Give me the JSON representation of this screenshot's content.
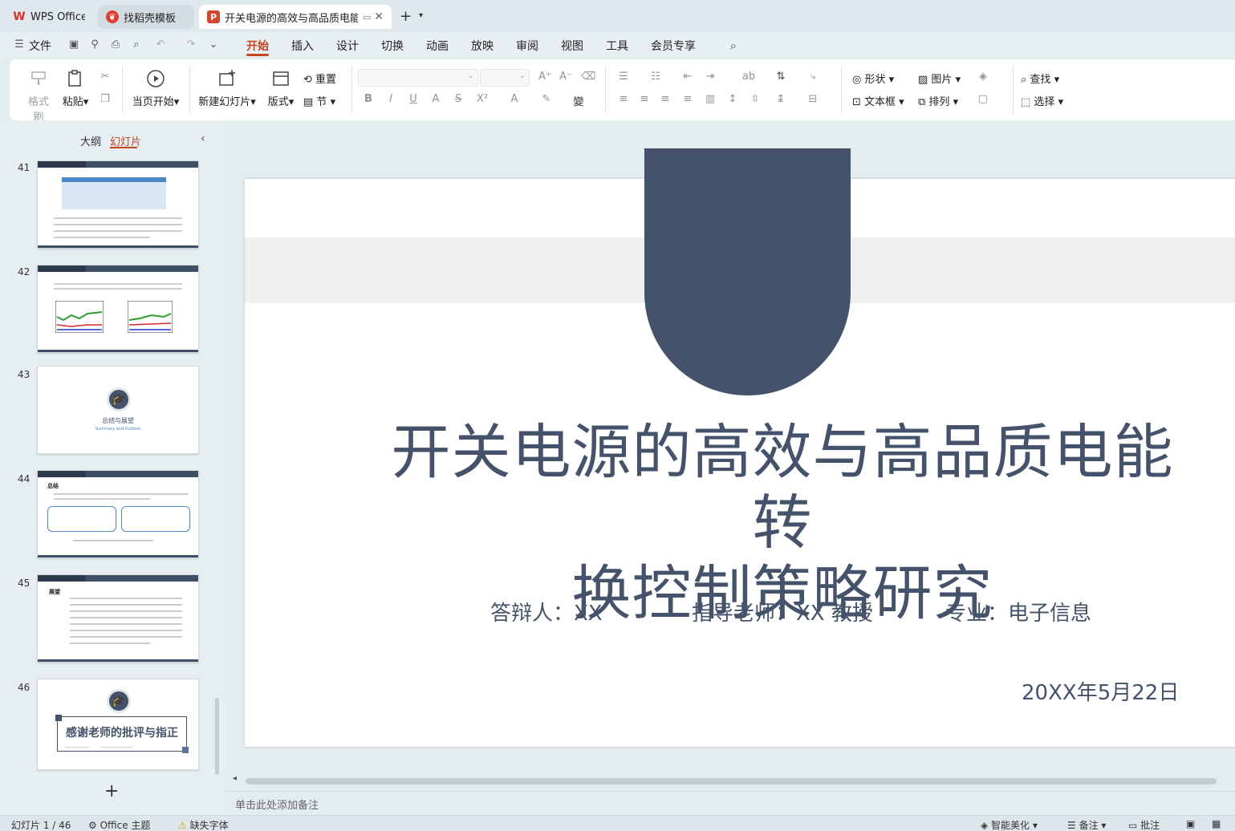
{
  "tabs": [
    {
      "label": "WPS Office",
      "icon": "wps-logo-icon"
    },
    {
      "label": "找稻壳模板",
      "icon": "docer-icon"
    },
    {
      "label": "开关电源的高效与高品质电能转",
      "icon": "presentation-icon"
    }
  ],
  "menu": {
    "file": "文件",
    "items": [
      "开始",
      "插入",
      "设计",
      "切换",
      "动画",
      "放映",
      "审阅",
      "视图",
      "工具",
      "会员专享"
    ],
    "active": "开始"
  },
  "ribbon": {
    "format_painter": "格式刷",
    "paste": "粘贴",
    "start_from_current": "当页开始",
    "new_slide": "新建幻灯片",
    "layout": "版式",
    "reset": "重置",
    "section": "节",
    "shape": "形状",
    "picture": "图片",
    "find": "查找",
    "textbox": "文本框",
    "arrange": "排列",
    "select": "选择"
  },
  "panel": {
    "outline_tab": "大纲",
    "slides_tab": "幻灯片",
    "slides": [
      {
        "num": "41",
        "kind": "table"
      },
      {
        "num": "42",
        "kind": "chart"
      },
      {
        "num": "43",
        "kind": "section",
        "title": "总结与展望",
        "subtitle": "Summary and Outlook"
      },
      {
        "num": "44",
        "kind": "summary",
        "heading": "总结"
      },
      {
        "num": "45",
        "kind": "text",
        "heading": "展望"
      },
      {
        "num": "46",
        "kind": "thanks",
        "title": "感谢老师的批评与指正"
      }
    ]
  },
  "slide": {
    "title_line1": "开关电源的高效与高品质电能转",
    "title_line2": "换控制策略研究",
    "presenter": "答辩人：XX",
    "advisor": "指导老师：XX  教授",
    "major": "专业：电子信息",
    "date": "20XX年5月22日",
    "accent_color": "#44536b"
  },
  "notes_placeholder": "单击此处添加备注",
  "status": {
    "slide_counter": "幻灯片 1 / 46",
    "theme": "Office 主题",
    "missing_font": "缺失字体",
    "smart_beautify": "智能美化",
    "notes": "备注",
    "comments": "批注"
  }
}
